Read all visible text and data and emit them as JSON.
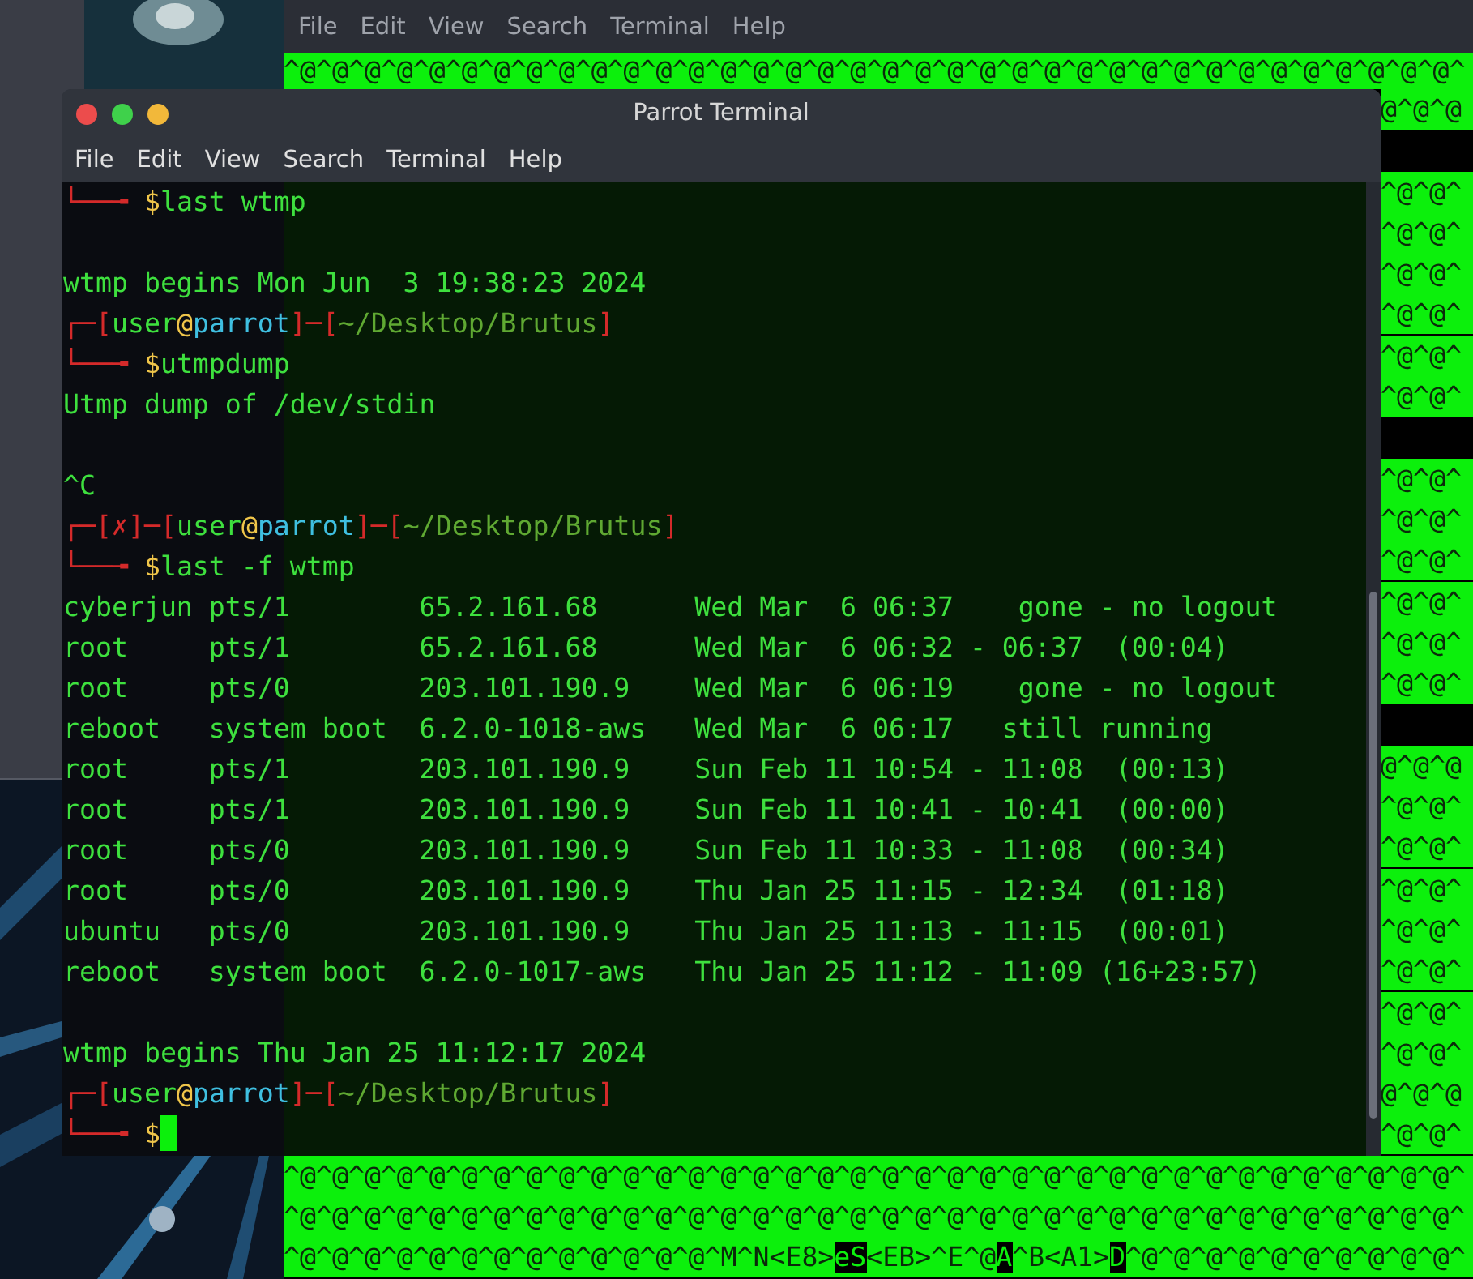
{
  "back_window": {
    "menu": [
      "File",
      "Edit",
      "View",
      "Search",
      "Terminal",
      "Help"
    ],
    "rows": [
      {
        "kind": "full",
        "segments": [
          {
            "text": "^@^@^@^@^@^@^@^@^@^@^@^@^@^@^@^@^@^@^@^@^@^@^@^@^@^@^@^@^@^@^@^@^@^@^@^@^",
            "inverse": false
          }
        ]
      },
      {
        "kind": "edge",
        "text": "@^@^@"
      },
      {
        "kind": "blank"
      },
      {
        "kind": "edge",
        "text": "^@^@^"
      },
      {
        "kind": "edge",
        "text": "^@^@^"
      },
      {
        "kind": "edge",
        "text": "^@^@^"
      },
      {
        "kind": "edge",
        "text": "^@^@^"
      },
      {
        "kind": "edge",
        "text": "^@^@^"
      },
      {
        "kind": "edge",
        "text": "^@^@^"
      },
      {
        "kind": "blank"
      },
      {
        "kind": "edge",
        "text": "^@^@^"
      },
      {
        "kind": "edge",
        "text": "^@^@^"
      },
      {
        "kind": "edge",
        "text": "^@^@^"
      },
      {
        "kind": "edge",
        "text": "^@^@^"
      },
      {
        "kind": "edge",
        "text": "^@^@^"
      },
      {
        "kind": "edge",
        "text": "^@^@^"
      },
      {
        "kind": "blank"
      },
      {
        "kind": "edge",
        "text": "@^@^@"
      },
      {
        "kind": "edge",
        "text": "^@^@^"
      },
      {
        "kind": "edge",
        "text": "^@^@^"
      },
      {
        "kind": "edge",
        "text": "^@^@^"
      },
      {
        "kind": "edge",
        "text": "^@^@^"
      },
      {
        "kind": "edge",
        "text": "^@^@^"
      },
      {
        "kind": "edge",
        "text": "^@^@^"
      },
      {
        "kind": "edge",
        "text": "^@^@^"
      },
      {
        "kind": "edge",
        "text": "@^@^@"
      },
      {
        "kind": "edge",
        "text": "^@^@^"
      },
      {
        "kind": "full",
        "segments": [
          {
            "text": "^@^@^@^@^@^@^@^@^@^@^@^@^@^@^@^@^@^@^@^@^@^@^@^@^@^@^@^@^@^@^@^@^@^@^@^@^",
            "inverse": false
          }
        ]
      },
      {
        "kind": "full",
        "segments": [
          {
            "text": "^@^@^@^@^@^@^@^@^@^@^@^@^@^@^@^@^@^@^@^@^@^@^@^@^@^@^@^@^@^@^@^@^@^@^@^@^",
            "inverse": false
          }
        ]
      },
      {
        "kind": "full",
        "segments": [
          {
            "text": "^@^@^@^@^@^@^@^@^@^@^@^@^@^M^N<E8>",
            "inverse": false
          },
          {
            "text": "eS",
            "inverse": true
          },
          {
            "text": "<EB>^E^@",
            "inverse": false
          },
          {
            "text": "A",
            "inverse": true
          },
          {
            "text": "^B<A1>",
            "inverse": false
          },
          {
            "text": "D",
            "inverse": true
          },
          {
            "text": "^@^@^@^@^@^@^@^@^@^@^",
            "inverse": false
          }
        ]
      }
    ]
  },
  "window": {
    "title": "Parrot Terminal",
    "menu": [
      "File",
      "Edit",
      "View",
      "Search",
      "Terminal",
      "Help"
    ],
    "lines": [
      {
        "kind": "command",
        "cursor": false,
        "segments": [
          {
            "text": "└──╼ ",
            "kind": "frame"
          },
          {
            "text": "$",
            "kind": "dollar"
          },
          {
            "text": "last wtmp",
            "kind": "text"
          }
        ]
      },
      {
        "kind": "blank"
      },
      {
        "kind": "output",
        "segments": [
          {
            "text": "wtmp begins Mon Jun  3 19:38:23 2024",
            "kind": "text"
          }
        ]
      },
      {
        "kind": "prompt",
        "segments": [
          {
            "text": "┌─[",
            "kind": "frame"
          },
          {
            "text": "user",
            "kind": "user"
          },
          {
            "text": "@",
            "kind": "at"
          },
          {
            "text": "parrot",
            "kind": "host"
          },
          {
            "text": "]─[",
            "kind": "frame"
          },
          {
            "text": "~/Desktop/Brutus",
            "kind": "path"
          },
          {
            "text": "]",
            "kind": "frame"
          }
        ]
      },
      {
        "kind": "command",
        "cursor": false,
        "segments": [
          {
            "text": "└──╼ ",
            "kind": "frame"
          },
          {
            "text": "$",
            "kind": "dollar"
          },
          {
            "text": "utmpdump",
            "kind": "text"
          }
        ]
      },
      {
        "kind": "output",
        "segments": [
          {
            "text": "Utmp dump of /dev/stdin",
            "kind": "text"
          }
        ]
      },
      {
        "kind": "blank"
      },
      {
        "kind": "output",
        "segments": [
          {
            "text": "^C",
            "kind": "text"
          }
        ]
      },
      {
        "kind": "prompt",
        "segments": [
          {
            "text": "┌─[",
            "kind": "frame"
          },
          {
            "text": "✗",
            "kind": "status"
          },
          {
            "text": "]─[",
            "kind": "frame"
          },
          {
            "text": "user",
            "kind": "user"
          },
          {
            "text": "@",
            "kind": "at"
          },
          {
            "text": "parrot",
            "kind": "host"
          },
          {
            "text": "]─[",
            "kind": "frame"
          },
          {
            "text": "~/Desktop/Brutus",
            "kind": "path"
          },
          {
            "text": "]",
            "kind": "frame"
          }
        ]
      },
      {
        "kind": "command",
        "cursor": false,
        "segments": [
          {
            "text": "└──╼ ",
            "kind": "frame"
          },
          {
            "text": "$",
            "kind": "dollar"
          },
          {
            "text": "last -f wtmp",
            "kind": "text"
          }
        ]
      },
      {
        "kind": "output",
        "segments": [
          {
            "text": "cyberjun pts/1        65.2.161.68      Wed Mar  6 06:37    gone - no logout",
            "kind": "text"
          }
        ]
      },
      {
        "kind": "output",
        "segments": [
          {
            "text": "root     pts/1        65.2.161.68      Wed Mar  6 06:32 - 06:37  (00:04)",
            "kind": "text"
          }
        ]
      },
      {
        "kind": "output",
        "segments": [
          {
            "text": "root     pts/0        203.101.190.9    Wed Mar  6 06:19    gone - no logout",
            "kind": "text"
          }
        ]
      },
      {
        "kind": "output",
        "segments": [
          {
            "text": "reboot   system boot  6.2.0-1018-aws   Wed Mar  6 06:17   still running",
            "kind": "text"
          }
        ]
      },
      {
        "kind": "output",
        "segments": [
          {
            "text": "root     pts/1        203.101.190.9    Sun Feb 11 10:54 - 11:08  (00:13)",
            "kind": "text"
          }
        ]
      },
      {
        "kind": "output",
        "segments": [
          {
            "text": "root     pts/1        203.101.190.9    Sun Feb 11 10:41 - 10:41  (00:00)",
            "kind": "text"
          }
        ]
      },
      {
        "kind": "output",
        "segments": [
          {
            "text": "root     pts/0        203.101.190.9    Sun Feb 11 10:33 - 11:08  (00:34)",
            "kind": "text"
          }
        ]
      },
      {
        "kind": "output",
        "segments": [
          {
            "text": "root     pts/0        203.101.190.9    Thu Jan 25 11:15 - 12:34  (01:18)",
            "kind": "text"
          }
        ]
      },
      {
        "kind": "output",
        "segments": [
          {
            "text": "ubuntu   pts/0        203.101.190.9    Thu Jan 25 11:13 - 11:15  (00:01)",
            "kind": "text"
          }
        ]
      },
      {
        "kind": "output",
        "segments": [
          {
            "text": "reboot   system boot  6.2.0-1017-aws   Thu Jan 25 11:12 - 11:09 (16+23:57)",
            "kind": "text"
          }
        ]
      },
      {
        "kind": "blank"
      },
      {
        "kind": "output",
        "segments": [
          {
            "text": "wtmp begins Thu Jan 25 11:12:17 2024",
            "kind": "text"
          }
        ]
      },
      {
        "kind": "prompt",
        "segments": [
          {
            "text": "┌─[",
            "kind": "frame"
          },
          {
            "text": "user",
            "kind": "user"
          },
          {
            "text": "@",
            "kind": "at"
          },
          {
            "text": "parrot",
            "kind": "host"
          },
          {
            "text": "]─[",
            "kind": "frame"
          },
          {
            "text": "~/Desktop/Brutus",
            "kind": "path"
          },
          {
            "text": "]",
            "kind": "frame"
          }
        ]
      },
      {
        "kind": "command",
        "cursor": true,
        "segments": [
          {
            "text": "└──╼ ",
            "kind": "frame"
          },
          {
            "text": "$",
            "kind": "dollar"
          }
        ]
      }
    ]
  }
}
